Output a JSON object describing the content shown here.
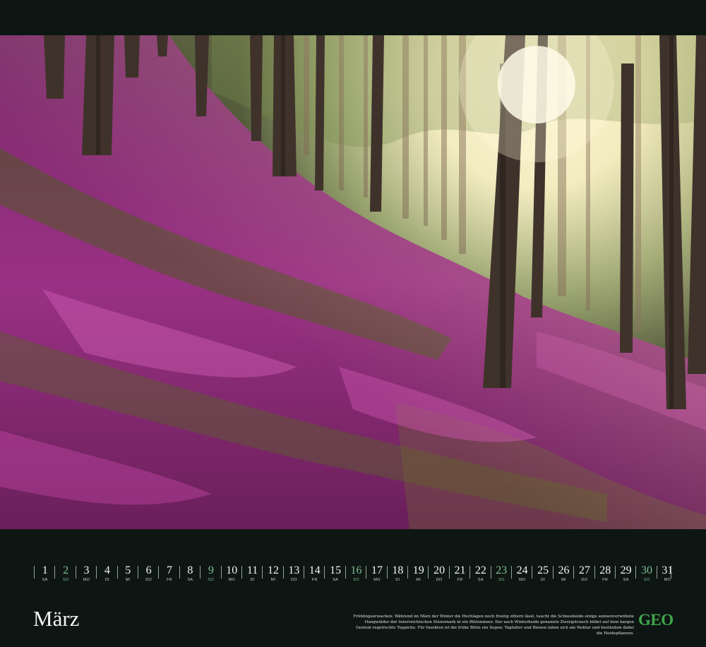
{
  "month": "März",
  "logo": "GEO",
  "caption": "Frühlingserwachen: Während im März der Winter die Hochlagen noch frostig zittern lässt, taucht die Schneeheide einige sonnenverwöhnte Hangwälder der österreichischen Steiermark in ein Blütenmeer. Der auch Winterheide genannte Zwergstrauch bildet auf dem kargen Gestein regelrechte Teppiche. Für Insekten ist die frühe Blüte ein Segen: Tagfalter und Bienen laben sich am Nektar und bestäuben dabei die Heidepflanzen.",
  "photo": {
    "subject": "heather-forest-slope",
    "colors": {
      "heather": "#9c2f86",
      "moss": "#4f5a22",
      "sky": "#fbf5dc",
      "trunk": "#4a3a30"
    }
  },
  "days": [
    {
      "n": "1",
      "wd": "SA",
      "sun": false
    },
    {
      "n": "2",
      "wd": "SO",
      "sun": true
    },
    {
      "n": "3",
      "wd": "MO",
      "sun": false
    },
    {
      "n": "4",
      "wd": "DI",
      "sun": false
    },
    {
      "n": "5",
      "wd": "MI",
      "sun": false
    },
    {
      "n": "6",
      "wd": "DO",
      "sun": false
    },
    {
      "n": "7",
      "wd": "FR",
      "sun": false
    },
    {
      "n": "8",
      "wd": "SA",
      "sun": false
    },
    {
      "n": "9",
      "wd": "SO",
      "sun": true
    },
    {
      "n": "10",
      "wd": "MO",
      "sun": false
    },
    {
      "n": "11",
      "wd": "DI",
      "sun": false
    },
    {
      "n": "12",
      "wd": "MI",
      "sun": false
    },
    {
      "n": "13",
      "wd": "DO",
      "sun": false
    },
    {
      "n": "14",
      "wd": "FR",
      "sun": false
    },
    {
      "n": "15",
      "wd": "SA",
      "sun": false
    },
    {
      "n": "16",
      "wd": "SO",
      "sun": true
    },
    {
      "n": "17",
      "wd": "MO",
      "sun": false
    },
    {
      "n": "18",
      "wd": "DI",
      "sun": false
    },
    {
      "n": "19",
      "wd": "MI",
      "sun": false
    },
    {
      "n": "20",
      "wd": "DO",
      "sun": false
    },
    {
      "n": "21",
      "wd": "FR",
      "sun": false
    },
    {
      "n": "22",
      "wd": "SA",
      "sun": false
    },
    {
      "n": "23",
      "wd": "SO",
      "sun": true
    },
    {
      "n": "24",
      "wd": "MO",
      "sun": false
    },
    {
      "n": "25",
      "wd": "DI",
      "sun": false
    },
    {
      "n": "26",
      "wd": "MI",
      "sun": false
    },
    {
      "n": "27",
      "wd": "DO",
      "sun": false
    },
    {
      "n": "28",
      "wd": "FR",
      "sun": false
    },
    {
      "n": "29",
      "wd": "SA",
      "sun": false
    },
    {
      "n": "30",
      "wd": "SO",
      "sun": true
    },
    {
      "n": "31",
      "wd": "MO",
      "sun": false
    }
  ]
}
